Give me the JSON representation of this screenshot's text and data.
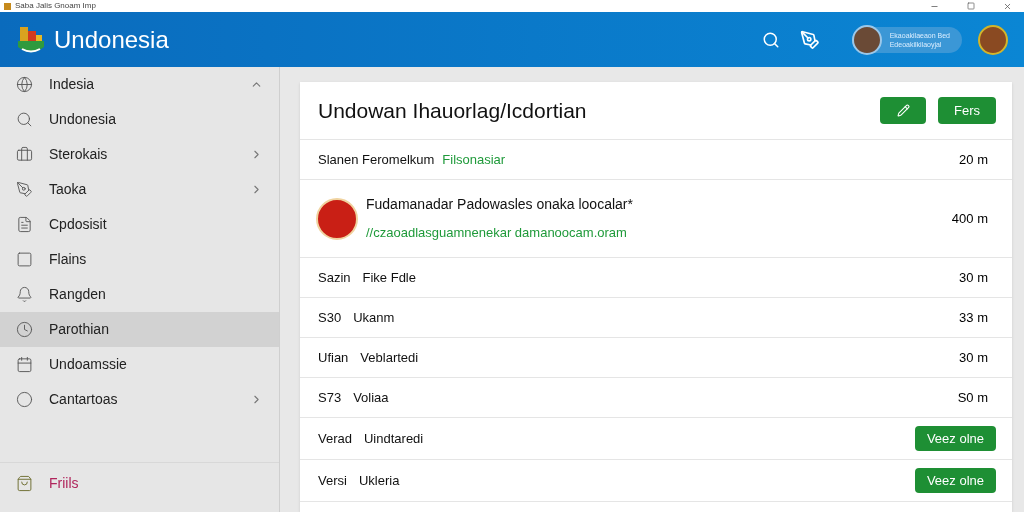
{
  "window": {
    "title": "Saba Jalis  Gnoam  Imp"
  },
  "header": {
    "brand": "Undonesia",
    "profile_text": [
      "Ekaoakilaeaon Bed",
      "Edeoakilkilaoyjal"
    ]
  },
  "sidebar": {
    "items": [
      {
        "label": "Indesia",
        "kind": "group",
        "expanded": true,
        "selected": false
      },
      {
        "label": "Undonesia",
        "kind": "link",
        "expanded": false,
        "selected": false
      },
      {
        "label": "Sterokais",
        "kind": "group",
        "expanded": false,
        "selected": false
      },
      {
        "label": "Taoka",
        "kind": "group",
        "expanded": false,
        "selected": false
      },
      {
        "label": "Cpdosisit",
        "kind": "link",
        "expanded": false,
        "selected": false
      },
      {
        "label": "Flains",
        "kind": "link",
        "expanded": false,
        "selected": false
      },
      {
        "label": "Rangden",
        "kind": "link",
        "expanded": false,
        "selected": false
      },
      {
        "label": "Parothian",
        "kind": "link",
        "expanded": false,
        "selected": true
      },
      {
        "label": "Undoamssie",
        "kind": "link",
        "expanded": false,
        "selected": false
      },
      {
        "label": "Cantartoas",
        "kind": "group",
        "expanded": false,
        "selected": false
      }
    ],
    "footer_item": {
      "label": "Friils"
    }
  },
  "panel": {
    "title": "Undowan Ihauorlag/Icdortian",
    "button": "Fers",
    "rows": [
      {
        "kind": "plain",
        "lead": "Slanen Feromelkum",
        "tag": "Filsonasiar",
        "value": "20 m"
      },
      {
        "kind": "featured",
        "lead": "Fudamanadar Padowasles onaka loocalar*",
        "link": "//czaoadlasguamnenekar damanoocam.oram",
        "value": "400 m"
      },
      {
        "kind": "plain",
        "lead": "Sazin",
        "name": "Fike Fdle",
        "value": "30 m"
      },
      {
        "kind": "plain",
        "lead": "S30",
        "name": "Ukanm",
        "value": "33 m"
      },
      {
        "kind": "plain",
        "lead": "Ufian",
        "name": "Veblartedi",
        "value": "30 m"
      },
      {
        "kind": "plain",
        "lead": "S73",
        "name": "Voliaa",
        "value": "S0 m"
      },
      {
        "kind": "action",
        "lead": "Verad",
        "name": "Uindtaredi",
        "button": "Veez olne"
      },
      {
        "kind": "action",
        "lead": "Versi",
        "name": "Ukleria",
        "button": "Veez olne"
      }
    ]
  }
}
